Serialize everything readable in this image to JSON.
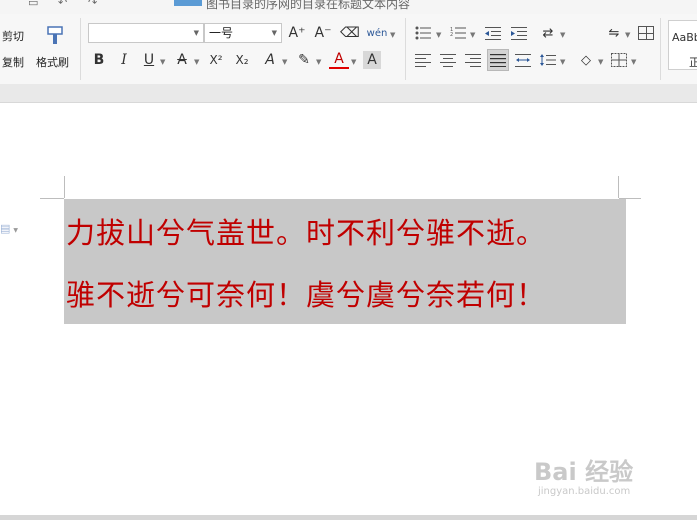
{
  "quick_access": {
    "undo_glyph": "↶",
    "redo_glyph": "↷",
    "cropped_title": "图书目录的序网的目录在标题文本内容"
  },
  "clipboard": {
    "cut_label": "剪切",
    "copy_label": "复制",
    "format_painter_label": "格式刷"
  },
  "font": {
    "family_value": "",
    "size_value": "一号"
  },
  "format_buttons": {
    "grow": "A⁺",
    "shrink": "A⁻",
    "clear": "⌫",
    "phonetic": "wén",
    "bold": "B",
    "italic": "I",
    "underline": "U",
    "strike": "A",
    "superscript": "X²",
    "subscript": "X₂",
    "text_effect": "A",
    "highlight": "✎",
    "font_color": "A",
    "char_shading": "A"
  },
  "styles": {
    "preview": "AaBbCcD",
    "name": "正文"
  },
  "document": {
    "line1": "力拔山兮气盖世。时不利兮骓不逝。",
    "line2": "骓不逝兮可奈何！虞兮虞兮奈若何！"
  },
  "watermark": {
    "brand": "Bai 经验",
    "url": "jingyan.baidu.com"
  },
  "colors": {
    "text_red": "#c00000",
    "selection_gray": "#c8c8c8"
  }
}
